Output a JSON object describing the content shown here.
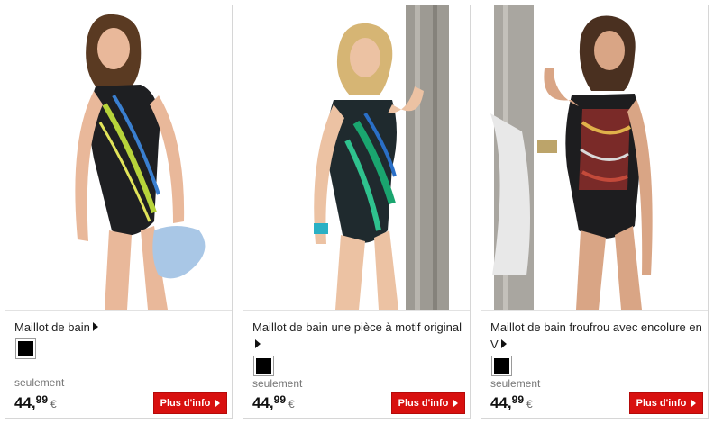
{
  "products": [
    {
      "title": "Maillot de bain",
      "only_label": "seulement",
      "price_main": "44,",
      "price_cents": "99",
      "currency": "€",
      "button_label": "Plus d'info",
      "swatch_color": "#000000",
      "image": "swimsuit-black-green-pattern"
    },
    {
      "title": "Maillot de bain une pièce à motif original",
      "only_label": "seulement",
      "price_main": "44,",
      "price_cents": "99",
      "currency": "€",
      "button_label": "Plus d'info",
      "swatch_color": "#000000",
      "image": "swimsuit-black-teal-pattern"
    },
    {
      "title": "Maillot de bain froufrou avec encolure en V",
      "only_label": "seulement",
      "price_main": "44,",
      "price_cents": "99",
      "currency": "€",
      "button_label": "Plus d'info",
      "swatch_color": "#000000",
      "image": "swimsuit-black-ruffle"
    }
  ],
  "colors": {
    "button_red": "#d8100f",
    "border": "#d6d6d6"
  }
}
